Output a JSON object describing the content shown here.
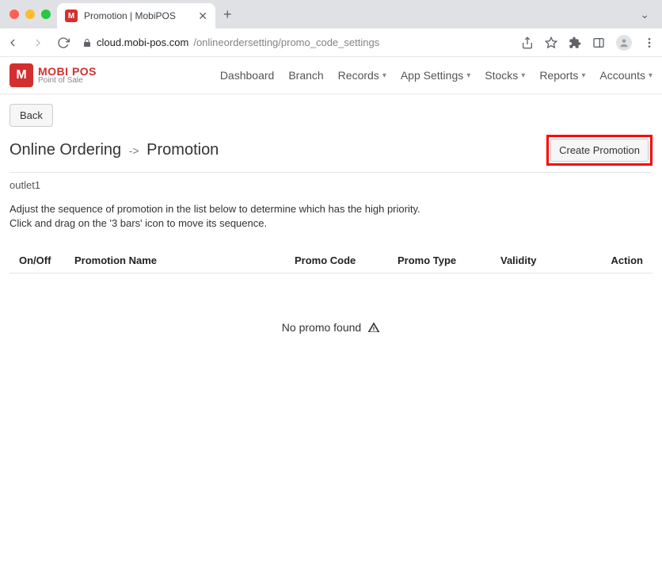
{
  "browser": {
    "tab_title": "Promotion | MobiPOS",
    "url_host": "cloud.mobi-pos.com",
    "url_path": "/onlineordersetting/promo_code_settings"
  },
  "brand": {
    "name": "MOBI POS",
    "tagline": "Point of Sale",
    "mark": "M",
    "accent_color": "#d32f2f"
  },
  "nav": {
    "items": [
      {
        "label": "Dashboard",
        "dropdown": false
      },
      {
        "label": "Branch",
        "dropdown": false
      },
      {
        "label": "Records",
        "dropdown": true
      },
      {
        "label": "App Settings",
        "dropdown": true
      },
      {
        "label": "Stocks",
        "dropdown": true
      },
      {
        "label": "Reports",
        "dropdown": true
      },
      {
        "label": "Accounts",
        "dropdown": true
      }
    ]
  },
  "page": {
    "back_label": "Back",
    "breadcrumb_parent": "Online Ordering",
    "breadcrumb_sep": "->",
    "breadcrumb_current": "Promotion",
    "create_label": "Create Promotion",
    "outlet": "outlet1",
    "instructions_line1": "Adjust the sequence of promotion in the list below to determine which has the high priority.",
    "instructions_line2": "Click and drag on the '3 bars' icon to move its sequence."
  },
  "table": {
    "headers": {
      "onoff": "On/Off",
      "name": "Promotion Name",
      "code": "Promo Code",
      "type": "Promo Type",
      "validity": "Validity",
      "action": "Action"
    },
    "rows": [],
    "empty_text": "No promo found"
  }
}
